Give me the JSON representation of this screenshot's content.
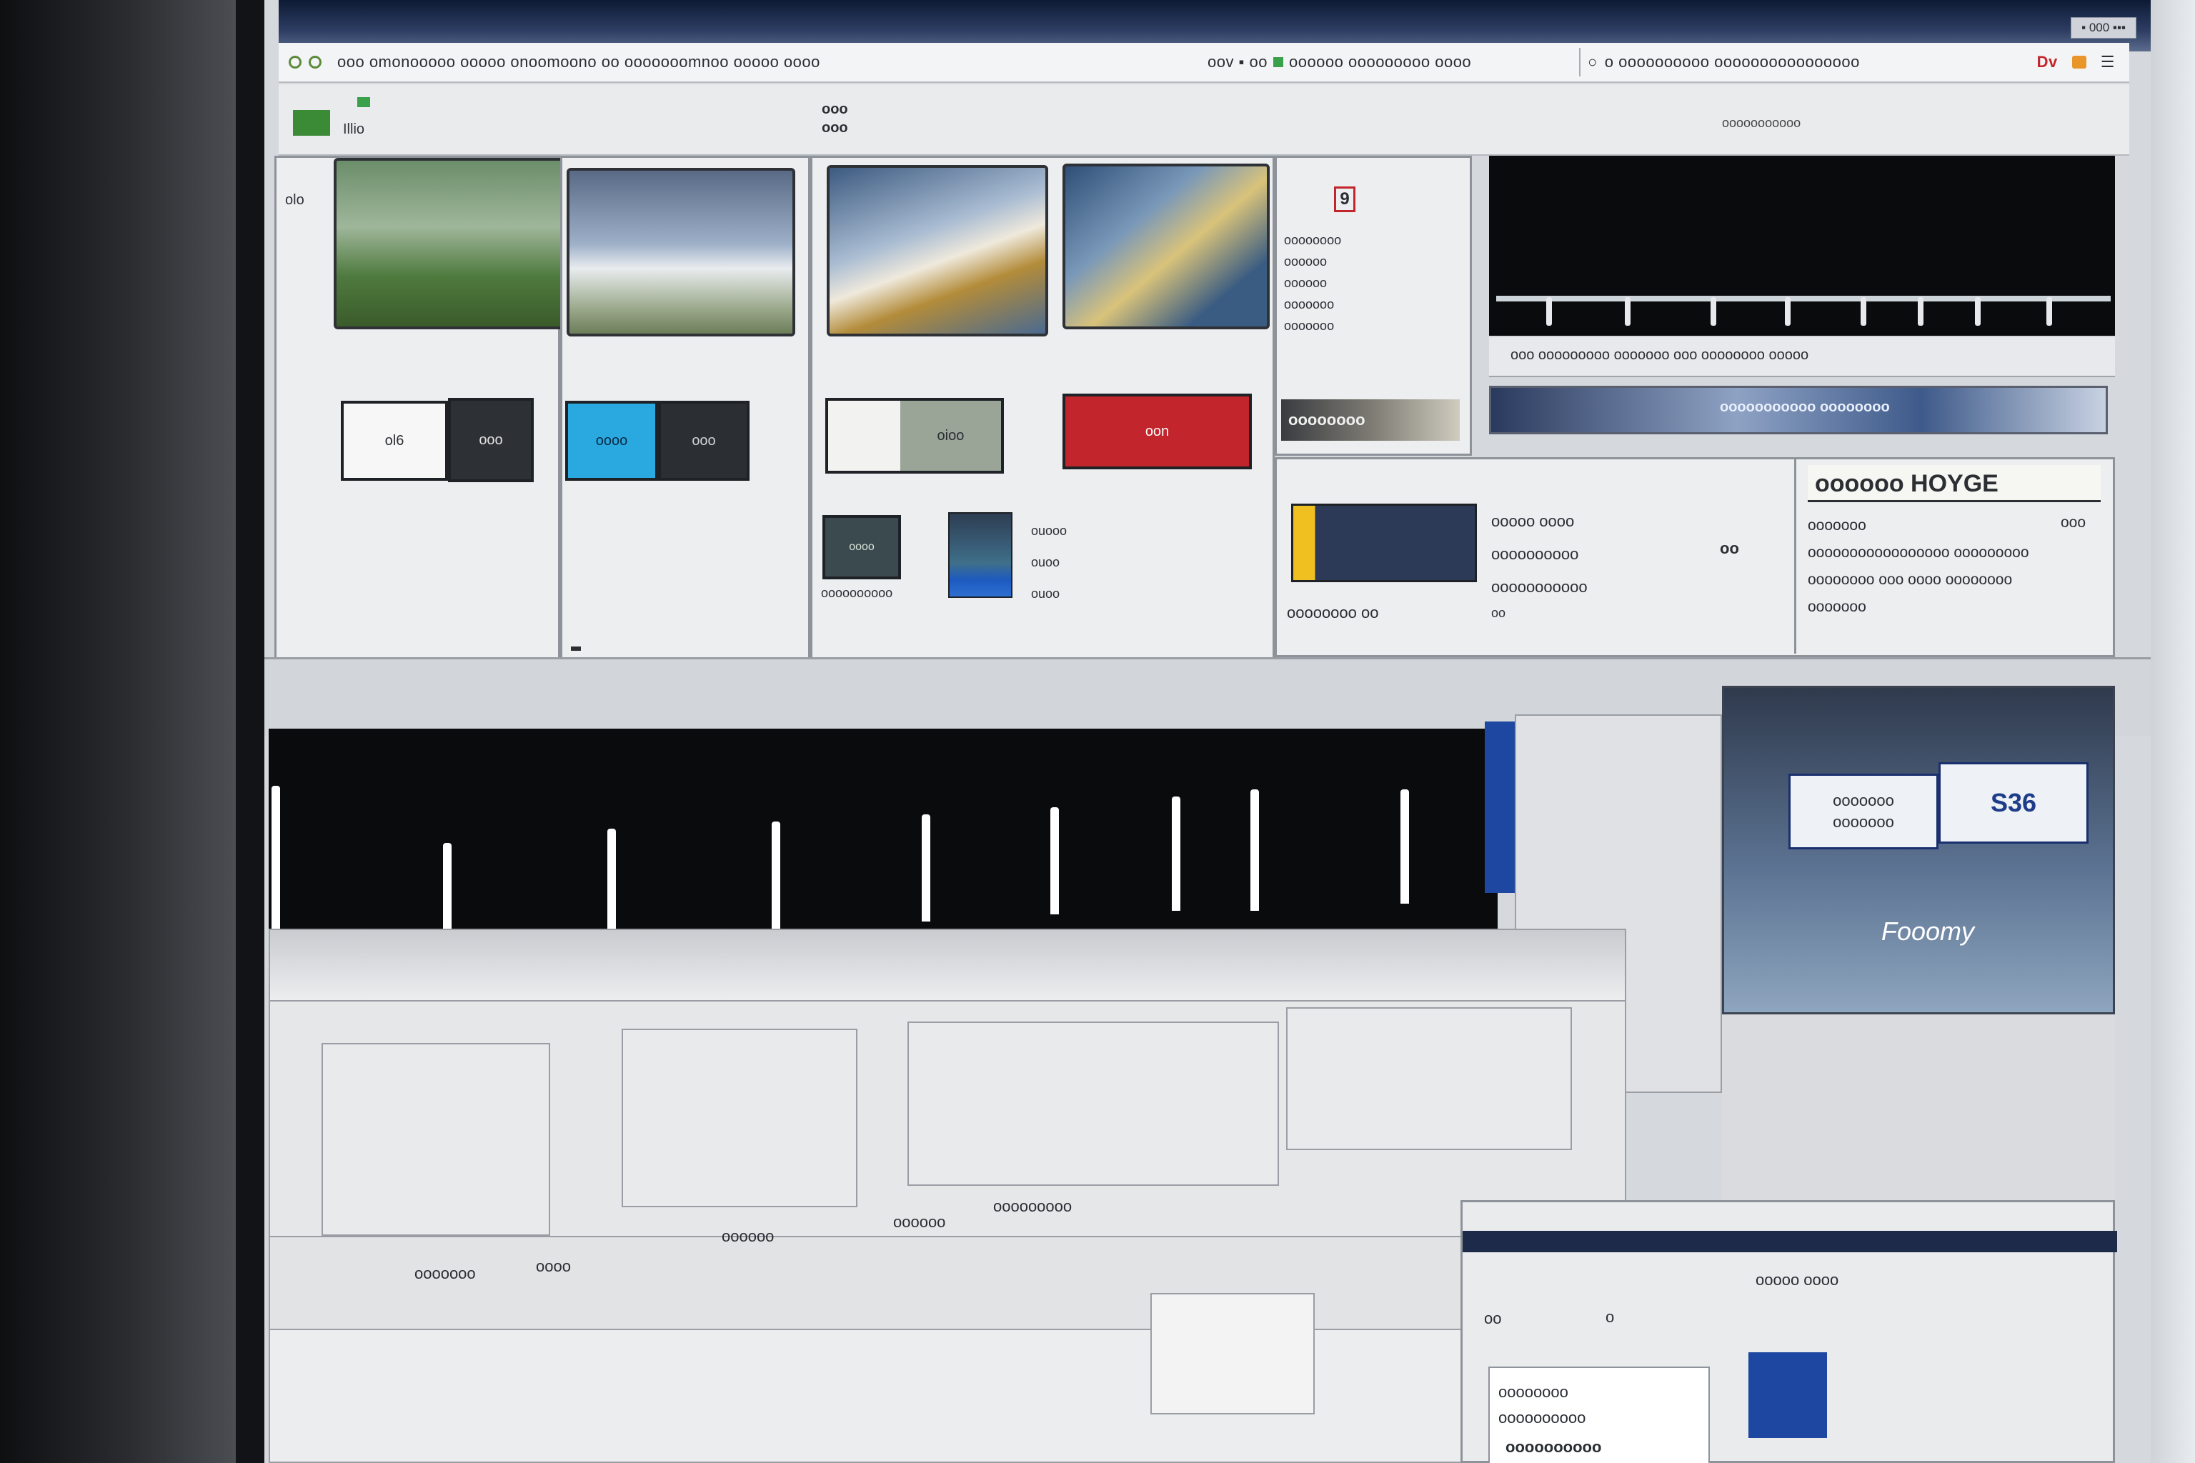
{
  "window": {
    "title_right": "▪ 000 ▪▪▪",
    "address": "ooo omonooooo ooooo onoomoono oo ooooooomnoo ooooo oooo",
    "address_mid": "oov ▪ oo",
    "address_right_1": "oooooo ooooooooo oooo",
    "address_right_2": "o oooooooooo oooooooooooooooo",
    "address_icon_label": "Dv"
  },
  "toolbar": {
    "left_label": "Illio",
    "center_line1": "ooo",
    "center_line2": "ooo",
    "right_label": "ooooooooooo"
  },
  "left_panel": {
    "side_label": "olo",
    "chip1": "ol6",
    "chip2": "ooo",
    "footer_icon": "o"
  },
  "panel2": {
    "chip_blue": "oooo",
    "chip_dark": "ooo"
  },
  "panel3": {
    "chip1": "oioo",
    "chip_red": "oon",
    "col_labels": [
      "ouooo",
      "ouoo",
      "ouoo"
    ],
    "chip_sub": "oooo",
    "chip_caption": "oooooooooo"
  },
  "doc_panel": {
    "badge": "9",
    "lines": [
      "oooooooo",
      "oooooo",
      "oooooo",
      "ooooooo",
      "ooooooo"
    ],
    "footer": "oooooooo"
  },
  "video": {
    "caption": "ooo ooooooooo ooooooo ooo oooooooo ooooo",
    "strip_label": "ooooooooooo oooooooo"
  },
  "info_block": {
    "heading": "oooooo HOYGE",
    "lines": [
      "ooooooo",
      "ooooooooooooooooo ooooooooo",
      "oooooooo ooo oooo oooooooo",
      "ooooooo"
    ],
    "tag": "ooo"
  },
  "mid_panel": {
    "lines": [
      "ooooo oooo",
      "oooooooooo",
      "ooooooooooo"
    ],
    "footer": "oooooooo oo",
    "side": "oo",
    "side2": "oo"
  },
  "hero": {
    "button_text_1": "ooooooo",
    "button_text_2": "ooooooo",
    "button_right": "S36",
    "caption": "Fooomy"
  },
  "bottom": {
    "labels": [
      "ooooooo",
      "oooo",
      "oooooo",
      "oooooo",
      "ooooooooo"
    ],
    "card_title": "ooooo oooo",
    "card_label": "oo",
    "card_value": "o",
    "card_lines": [
      "oooooooo",
      "oooooooooo"
    ],
    "card_footer": "oooooooooo"
  },
  "colors": {
    "accent_blue": "#1d47a0",
    "green": "#3a8a36",
    "red": "#c2262c",
    "cyan": "#2aa9e0"
  }
}
